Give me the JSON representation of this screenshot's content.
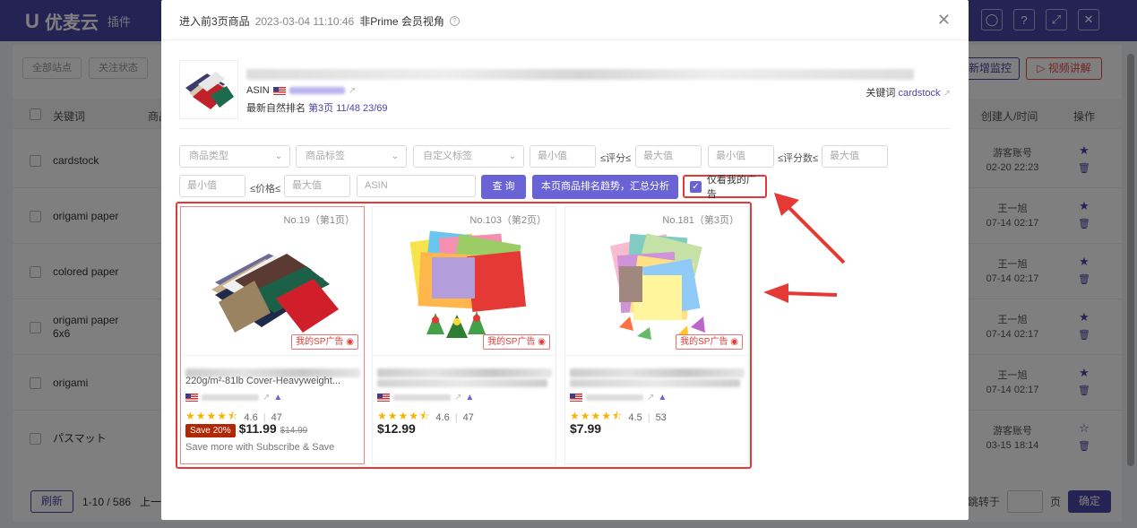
{
  "app": {
    "logo_text": "优麦云",
    "logo_sub": "插件",
    "top_icons": [
      "user-icon",
      "help-icon",
      "collapse-icon",
      "close-icon"
    ],
    "filters": [
      "全部站点",
      "关注状态"
    ],
    "btn_add": "新增监控",
    "btn_video": "视频讲解",
    "th_keyword": "关键词",
    "th_product": "商品",
    "th_creator": "创建人/时间",
    "th_action": "操作",
    "rows": [
      {
        "keyword": "cardstock",
        "creator": "游客账号",
        "time": "02-20 22:23"
      },
      {
        "keyword": "origami paper",
        "creator": "王一旭",
        "time": "07-14 02:17"
      },
      {
        "keyword": "colored paper",
        "creator": "王一旭",
        "time": "07-14 02:17"
      },
      {
        "keyword": "origami paper 6x6",
        "creator": "王一旭",
        "time": "07-14 02:17"
      },
      {
        "keyword": "origami",
        "creator": "王一旭",
        "time": "07-14 02:17"
      },
      {
        "keyword": "パスマット",
        "creator": "游客账号",
        "time": "03-15 18:14"
      }
    ],
    "refresh": "刷新",
    "count": "1-10 / 586",
    "prev": "上一",
    "goto": "跳转于",
    "page_unit": "页",
    "confirm": "确定"
  },
  "modal": {
    "title": "进入前3页商品",
    "datetime": "2023-03-04 11:10:46",
    "view": "非Prime 会员视角",
    "asin_label": "ASIN",
    "rank_label": "最新自然排名",
    "rank_value": "第3页 11/48 23/69",
    "keyword_label": "关键词",
    "keyword_value": "cardstock",
    "filters": {
      "type": "商品类型",
      "tag": "商品标签",
      "custom_tag": "自定义标签",
      "min": "最小值",
      "max": "最大值",
      "rating_label": "≤评分≤",
      "reviews_label": "≤评分数≤",
      "price_label": "≤价格≤",
      "asin_placeholder": "ASIN",
      "query_btn": "查 询",
      "trend_btn": "本页商品排名趋势，汇总分析",
      "ad_only": "仅看我的广告",
      "ad_only_checked": true
    },
    "cards": [
      {
        "rank": "No.19（第1页）",
        "sp": "我的SP广告",
        "title_line": "220g/m²-81lb Cover-Heavyweight...",
        "rating": "4.6",
        "reviews": "47",
        "save": "Save 20%",
        "price": "$11.99",
        "was": "$14.99",
        "subscribe": "Save more with Subscribe & Save"
      },
      {
        "rank": "No.103（第2页）",
        "sp": "我的SP广告",
        "rating": "4.6",
        "reviews": "47",
        "price": "$12.99"
      },
      {
        "rank": "No.181（第3页）",
        "sp": "我的SP广告",
        "rating": "4.5",
        "reviews": "53",
        "price": "$7.99"
      }
    ]
  }
}
